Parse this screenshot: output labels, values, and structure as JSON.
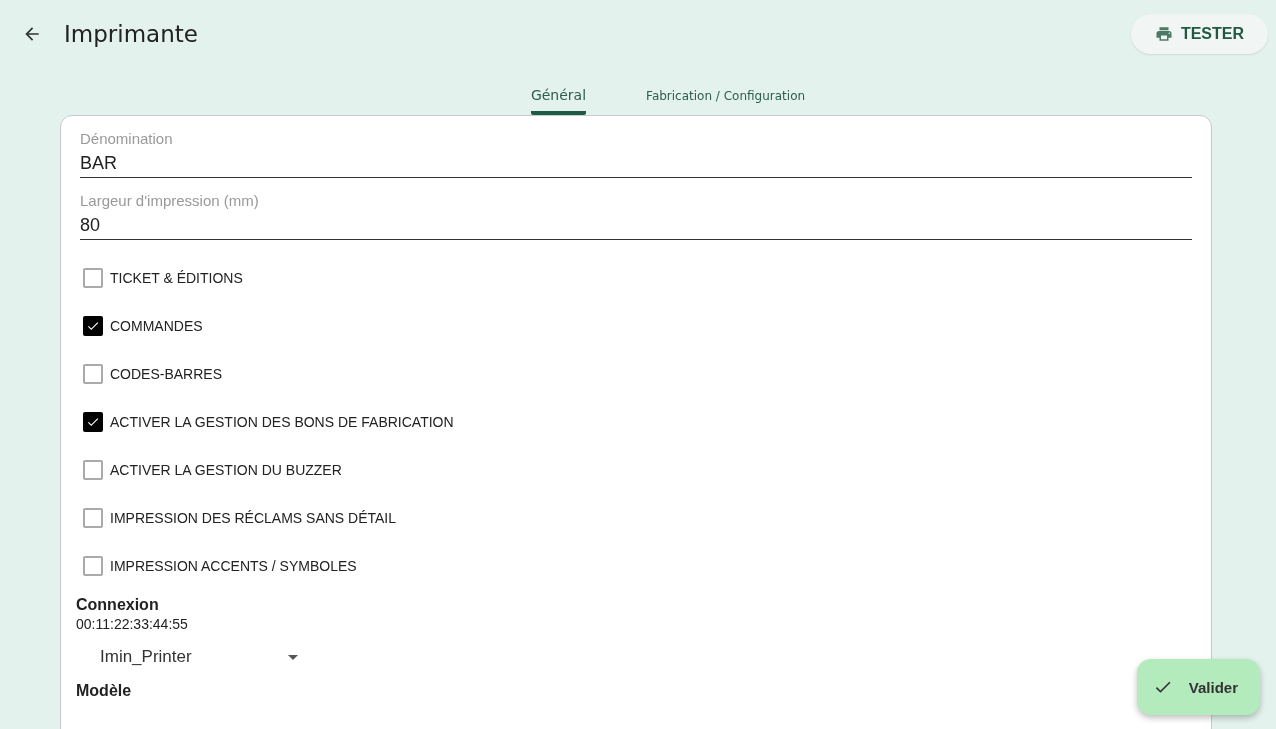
{
  "header": {
    "title": "Imprimante",
    "test_button": "TESTER"
  },
  "tabs": [
    {
      "label": "Général",
      "selected": true
    },
    {
      "label": "Fabrication / Configuration",
      "selected": false
    }
  ],
  "fields": [
    {
      "label": "Dénomination",
      "value": "BAR"
    },
    {
      "label": "Largeur d'impression (mm)",
      "value": "80"
    }
  ],
  "options": [
    {
      "label": "TICKET & ÉDITIONS",
      "checked": false
    },
    {
      "label": "COMMANDES",
      "checked": true
    },
    {
      "label": "CODES-BARRES",
      "checked": false
    },
    {
      "label": "ACTIVER LA GESTION DES BONS DE FABRICATION",
      "checked": true
    },
    {
      "label": "ACTIVER LA GESTION DU BUZZER",
      "checked": false
    },
    {
      "label": "IMPRESSION DES RÉCLAMS SANS DÉTAIL",
      "checked": false
    },
    {
      "label": "IMPRESSION ACCENTS / SYMBOLES",
      "checked": false
    }
  ],
  "connection": {
    "heading": "Connexion",
    "address": "00:11:22:33:44:55",
    "device": "Imin_Printer"
  },
  "model": {
    "heading": "Modèle"
  },
  "validate_button": "Valider"
}
